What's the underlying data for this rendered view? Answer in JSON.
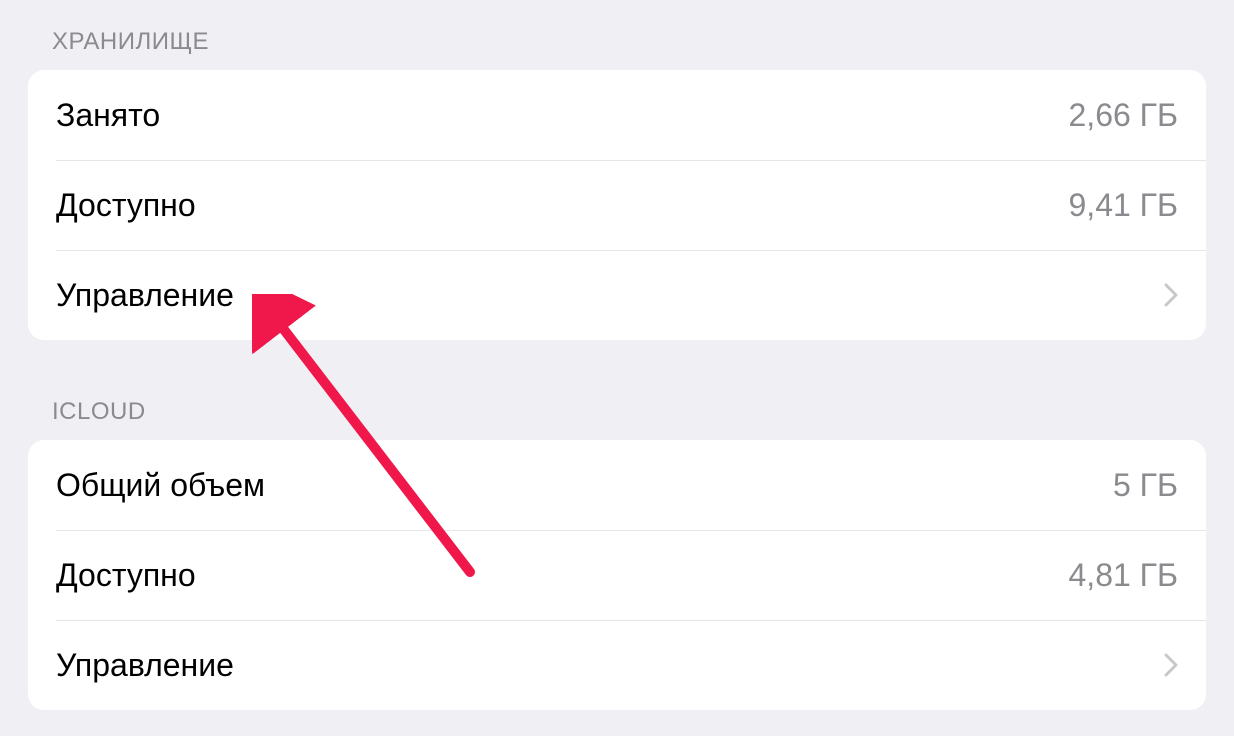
{
  "sections": {
    "storage": {
      "header": "ХРАНИЛИЩЕ",
      "used": {
        "label": "Занято",
        "value": "2,66 ГБ"
      },
      "available": {
        "label": "Доступно",
        "value": "9,41 ГБ"
      },
      "manage": {
        "label": "Управление"
      }
    },
    "icloud": {
      "header": "ICLOUD",
      "total": {
        "label": "Общий объем",
        "value": "5 ГБ"
      },
      "available": {
        "label": "Доступно",
        "value": "4,81 ГБ"
      },
      "manage": {
        "label": "Управление"
      }
    }
  },
  "colors": {
    "background": "#f0eff4",
    "card": "#ffffff",
    "textPrimary": "#000000",
    "textSecondary": "#8a8a8f",
    "separator": "#e5e5ea",
    "annotation": "#f0174a"
  }
}
